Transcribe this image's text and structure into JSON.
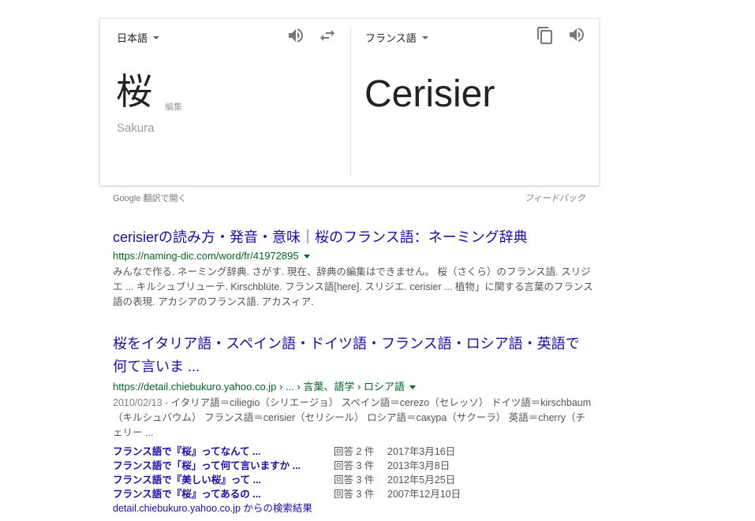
{
  "translator": {
    "source_lang": "日本語",
    "target_lang": "フランス語",
    "source_text": "桜",
    "edit_label": "編集",
    "romanization": "Sakura",
    "translation": "Cerisier",
    "open_link": "Google 翻訳で開く",
    "feedback_link": "フィードバック"
  },
  "results": [
    {
      "title": "cerisierの読み方・発音・意味｜桜のフランス語：ネーミング辞典",
      "url": "https://naming-dic.com/word/fr/41972895",
      "snippet": "みんなで作る. ネーミング辞典. さがす. 現在、辞典の編集はできません。 桜（さくら）のフランス語. スリジエ ... キルシュブリューテ. Kirschblüte. フランス語[here]. スリジエ. cerisier ... 植物」に関する言葉のフランス語の表現. アカシアのフランス語. アカスィア."
    },
    {
      "title_line1": "桜をイタリア語・スペイン語・ドイツ語・フランス語・ロシア語・英語で",
      "title_line2": "何て言いま ...",
      "url": "https://detail.chiebukuro.yahoo.co.jp › ... › 言葉、語学 › ロシア語",
      "date": "2010/02/13 - ",
      "snippet": "イタリア語＝ciliegio（シリエージョ） スペイン語＝cerezo（セレッソ） ドイツ語＝kirschbaum（キルシュバウム） フランス語＝cerisier（セリシール） ロシア語＝сакура（サクーラ） 英語＝cherry（チェリー ...",
      "sub_results": [
        {
          "title": "フランス語で『桜』ってなんて ...",
          "count": "回答 2 件",
          "date": "2017年3月16日"
        },
        {
          "title": "フランス語で「桜」って何て言いますか ...",
          "count": "回答 3 件",
          "date": "2013年3月8日"
        },
        {
          "title": "フランス語で『美しい桜』って ...",
          "count": "回答 3 件",
          "date": "2012年5月25日"
        },
        {
          "title": "フランス語で『桜』ってあるの ...",
          "count": "回答 3 件",
          "date": "2007年12月10日"
        }
      ],
      "site_link": "detail.chiebukuro.yahoo.co.jp からの検索結果"
    }
  ]
}
